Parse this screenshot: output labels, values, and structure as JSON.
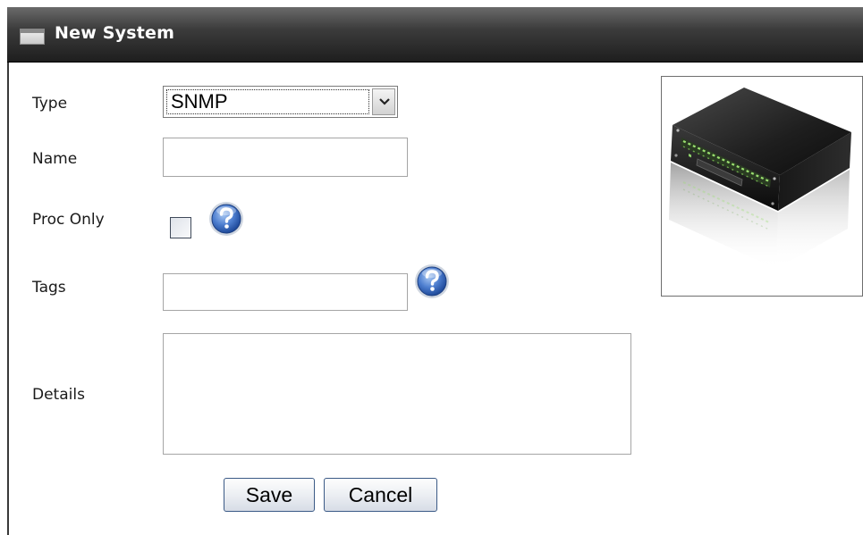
{
  "window": {
    "title": "New System"
  },
  "form": {
    "type": {
      "label": "Type",
      "selected": "SNMP"
    },
    "name": {
      "label": "Name",
      "value": ""
    },
    "proc_only": {
      "label": "Proc Only",
      "checked": false
    },
    "tags": {
      "label": "Tags",
      "value": ""
    },
    "details": {
      "label": "Details",
      "value": ""
    }
  },
  "buttons": {
    "save": "Save",
    "cancel": "Cancel"
  },
  "icons": {
    "window": "window-icon",
    "help": "question-mark-help-icon",
    "dropdown": "chevron-down-icon",
    "device": "rack-server-device-image"
  },
  "colors": {
    "titlebar": "#2c2c2c",
    "help_icon": "#3f6fc0",
    "button_border": "#3b5a86"
  }
}
